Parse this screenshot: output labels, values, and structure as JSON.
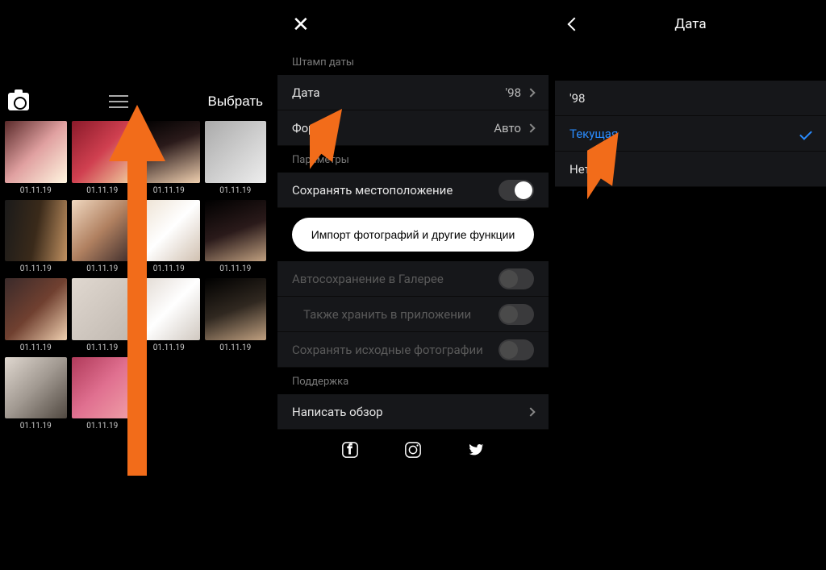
{
  "panel1": {
    "select_label": "Выбрать",
    "thumbs": [
      {
        "date": "01.11.19"
      },
      {
        "date": "01.11.19"
      },
      {
        "date": "01.11.19"
      },
      {
        "date": "01.11.19"
      },
      {
        "date": "01.11.19"
      },
      {
        "date": "01.11.19"
      },
      {
        "date": "01.11.19"
      },
      {
        "date": "01.11.19"
      },
      {
        "date": "01.11.19"
      },
      {
        "date": "01.11.19"
      },
      {
        "date": "01.11.19"
      },
      {
        "date": "01.11.19"
      },
      {
        "date": "01.11.19"
      },
      {
        "date": "01.11.19"
      }
    ]
  },
  "panel2": {
    "section_stamp": "Штамп даты",
    "date_label": "Дата",
    "date_value": "'98",
    "format_label": "Формат",
    "format_value": "Авто",
    "section_params": "Параметры",
    "save_location": "Сохранять местоположение",
    "import_btn": "Импорт фотографий и другие функции",
    "autosave": "Автосохранение в Галерее",
    "also_store": "Также хранить в приложении",
    "save_original": "Сохранять исходные фотографии",
    "section_support": "Поддержка",
    "write_review": "Написать обзор"
  },
  "panel3": {
    "title": "Дата",
    "opt1": "'98",
    "opt2": "Текущая",
    "opt3": "Нет"
  }
}
